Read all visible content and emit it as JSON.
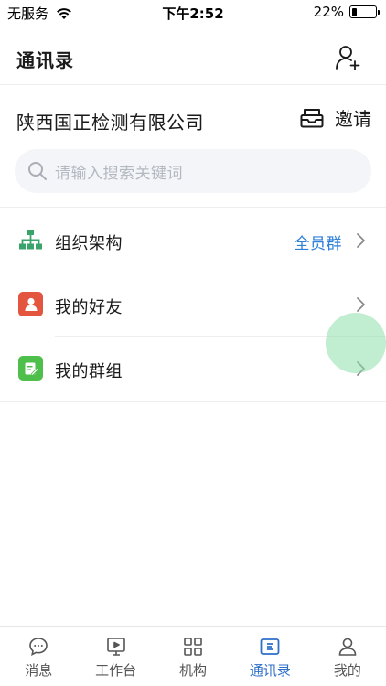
{
  "status_bar": {
    "carrier": "无服务",
    "time": "下午2:52",
    "battery_percent": "22%",
    "battery_level": 0.22
  },
  "header": {
    "title": "通讯录",
    "add_icon": "add-user-icon"
  },
  "company": {
    "name": "陕西国正检测有限公司",
    "invite_label": "邀请",
    "invite_icon": "inbox-icon"
  },
  "search": {
    "placeholder": "请输入搜索关键词",
    "icon": "search-icon"
  },
  "list": {
    "items": [
      {
        "label": "组织架构",
        "extra": "全员群",
        "icon": "org-chart-icon",
        "icon_color": "#3aa36b"
      },
      {
        "label": "我的好友",
        "extra": "",
        "icon": "person-icon",
        "icon_color": "#e4553f"
      },
      {
        "label": "我的群组",
        "extra": "",
        "icon": "note-edit-icon",
        "icon_color": "#4fbf4b"
      }
    ]
  },
  "tab_bar": {
    "tabs": [
      {
        "label": "消息",
        "icon": "chat-bubble-icon",
        "active": false
      },
      {
        "label": "工作台",
        "icon": "screen-play-icon",
        "active": false
      },
      {
        "label": "机构",
        "icon": "grid-icon",
        "active": false
      },
      {
        "label": "通讯录",
        "icon": "contact-card-icon",
        "active": true
      },
      {
        "label": "我的",
        "icon": "profile-icon",
        "active": false
      }
    ],
    "active_color": "#2f6ec9"
  }
}
